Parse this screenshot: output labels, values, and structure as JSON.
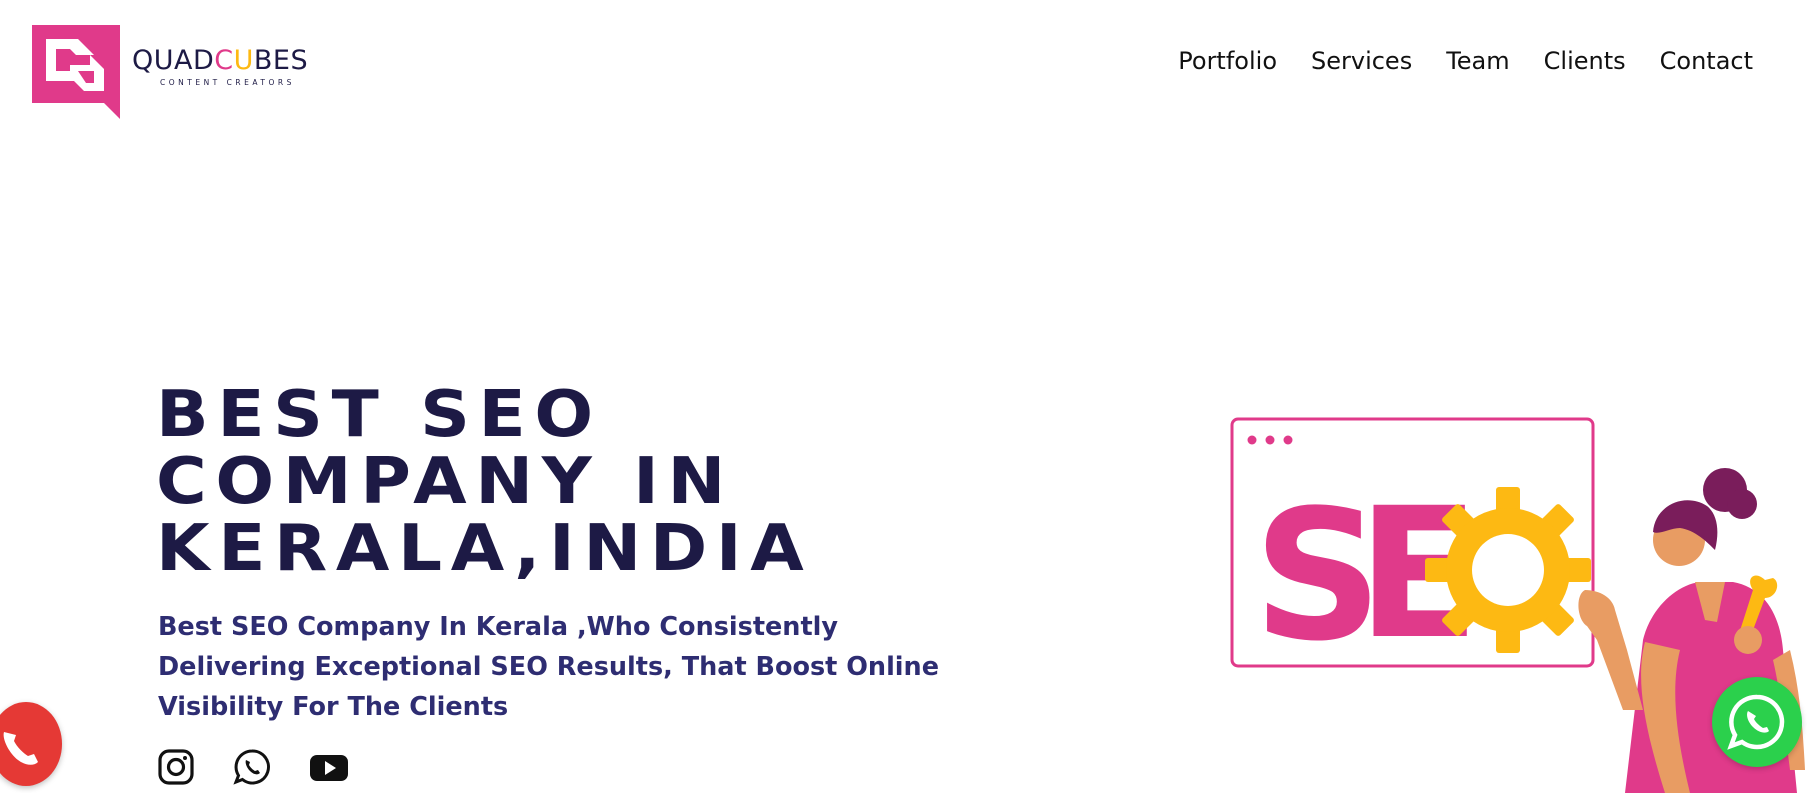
{
  "brand": {
    "name_parts": [
      "QUAD",
      "C",
      "U",
      "BES"
    ],
    "tagline": "CONTENT CREATORS",
    "colors": {
      "primary": "#e03a8a",
      "accent": "#fdb913",
      "dark": "#1d1a45",
      "subtitle": "#2e2d72"
    }
  },
  "nav": {
    "items": [
      {
        "label": "Portfolio"
      },
      {
        "label": "Services"
      },
      {
        "label": "Team"
      },
      {
        "label": "Clients"
      },
      {
        "label": "Contact"
      }
    ]
  },
  "hero": {
    "title_lines": [
      "BEST SEO",
      "COMPANY IN",
      "KERALA,INDIA"
    ],
    "subtitle_lines": [
      "Best SEO Company In Kerala ,Who Consistently",
      "Delivering Exceptional SEO Results, That Boost Online",
      "Visibility For The Clients"
    ],
    "illustration_text": {
      "s": "S",
      "e": "E"
    }
  },
  "socials": [
    {
      "icon": "instagram-icon"
    },
    {
      "icon": "whatsapp-icon"
    },
    {
      "icon": "youtube-icon"
    }
  ],
  "floating": {
    "call_icon": "phone-icon",
    "call_color": "#e53935",
    "whatsapp_icon": "whatsapp-icon",
    "whatsapp_color": "#2bd04c"
  }
}
